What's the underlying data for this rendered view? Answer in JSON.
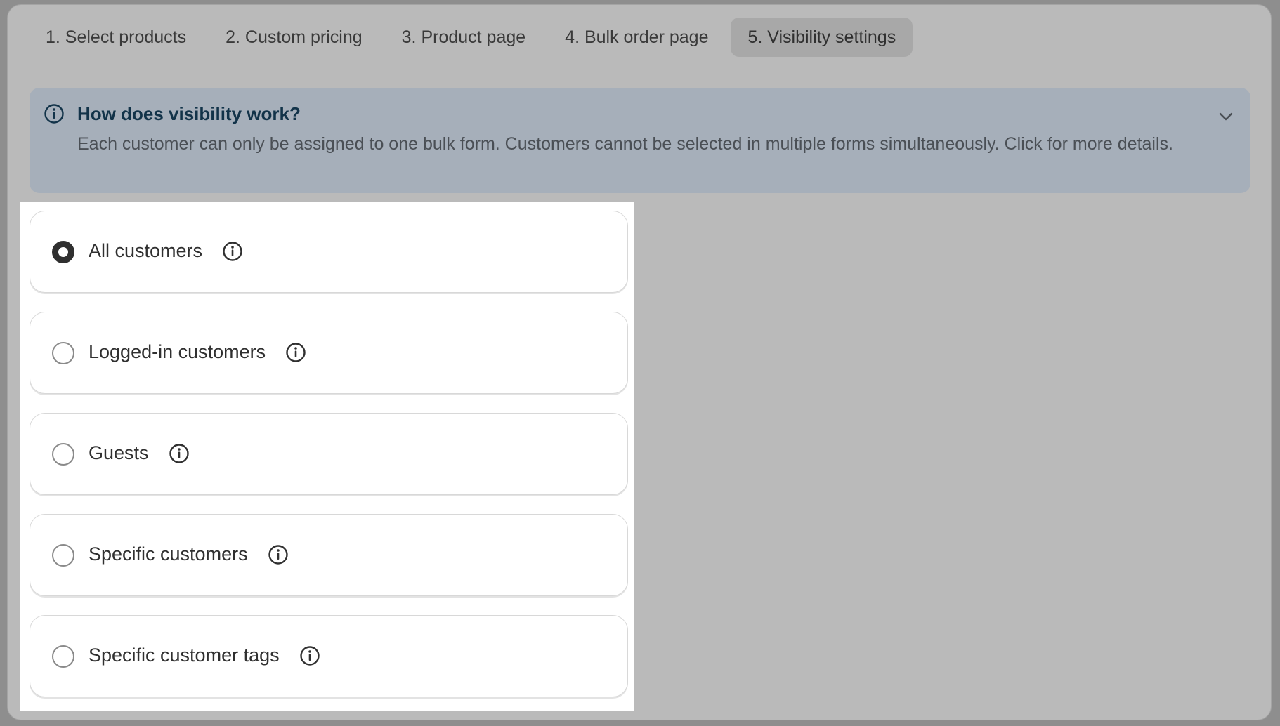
{
  "tabs": [
    {
      "label": "1. Select products",
      "active": false
    },
    {
      "label": "2. Custom pricing",
      "active": false
    },
    {
      "label": "3. Product page",
      "active": false
    },
    {
      "label": "4. Bulk order page",
      "active": false
    },
    {
      "label": "5. Visibility settings",
      "active": true
    }
  ],
  "banner": {
    "icon": "info-icon",
    "title": "How does visibility work?",
    "text": "Each customer can only be assigned to one bulk form. Customers cannot be selected in multiple forms simultaneously. Click for more details.",
    "toggle_icon": "chevron-down-icon",
    "background": "#a6afba",
    "title_color": "#123349"
  },
  "visibility_options": [
    {
      "label": "All customers",
      "selected": true,
      "icon": "info-icon"
    },
    {
      "label": "Logged-in customers",
      "selected": false,
      "icon": "info-icon"
    },
    {
      "label": "Guests",
      "selected": false,
      "icon": "info-icon"
    },
    {
      "label": "Specific customers",
      "selected": false,
      "icon": "info-icon"
    },
    {
      "label": "Specific customer tags",
      "selected": false,
      "icon": "info-icon"
    }
  ]
}
